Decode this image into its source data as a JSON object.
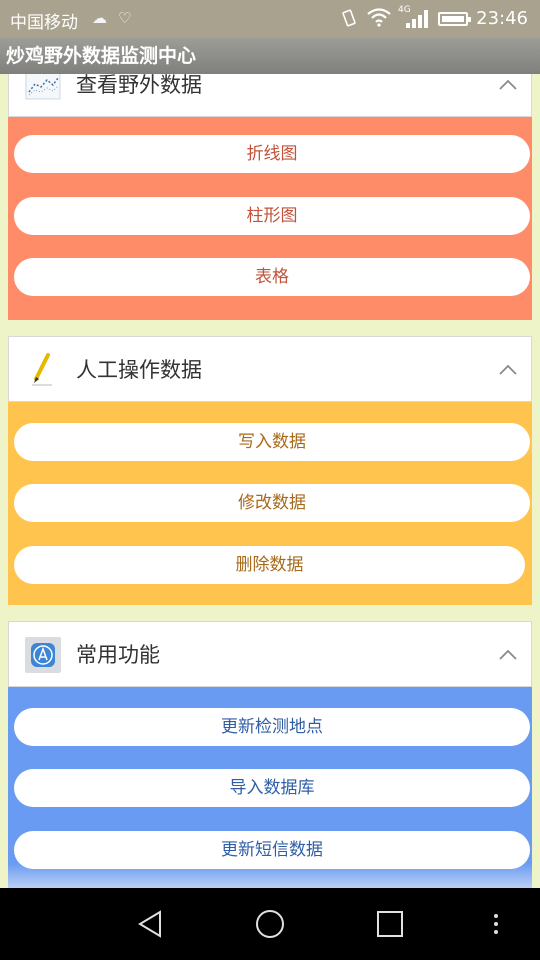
{
  "status_bar": {
    "carrier": "中国移动",
    "network": "4G",
    "time": "23:46"
  },
  "app": {
    "title": "炒鸡野外数据监测中心"
  },
  "sections": [
    {
      "title": "查看野外数据",
      "icon": "line-chart-icon",
      "color": "#ff8c69",
      "buttons": [
        "折线图",
        "柱形图",
        "表格"
      ]
    },
    {
      "title": "人工操作数据",
      "icon": "pencil-icon",
      "color": "#ffc44d",
      "buttons": [
        "写入数据",
        "修改数据",
        "删除数据"
      ]
    },
    {
      "title": "常用功能",
      "icon": "app-store-icon",
      "color": "#6a9bf2",
      "buttons": [
        "更新检测地点",
        "导入数据库",
        "更新短信数据"
      ]
    }
  ],
  "nav": [
    "back-icon",
    "home-icon",
    "recents-icon",
    "menu-icon"
  ]
}
